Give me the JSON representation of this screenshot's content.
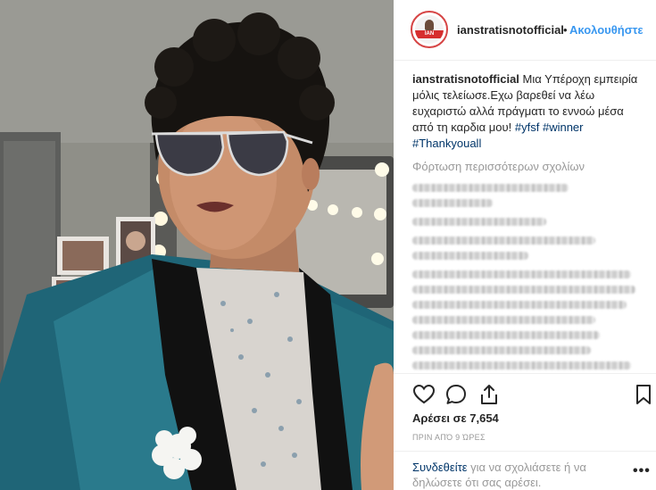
{
  "post": {
    "photo_name": "post-photo"
  },
  "header": {
    "username": "ianstratisnotofficial",
    "separator": "•",
    "follow_label": "Ακολουθήστε",
    "avatar_logo_text": "IAN"
  },
  "caption": {
    "username": "ianstratisnotofficial",
    "text": " Μια Υπέροχη εμπειρία μόλις τελείωσε.Εχω βαρεθεί να λέω ευχαριστώ αλλά πράγματι το εννοώ μέσα από τη καρδια μου! ",
    "hashtags": [
      "#yfsf",
      "#winner",
      "#Thankyouall"
    ]
  },
  "comments": {
    "load_more_label": "Φόρτωση περισσότερων σχολίων"
  },
  "actions": {
    "like_icon": "heart-icon",
    "comment_icon": "comment-icon",
    "share_icon": "share-icon",
    "save_icon": "bookmark-icon",
    "likes_text": "Αρέσει σε 7,654",
    "time_text": "ΠΡΙΝ ΑΠΌ 9 ΏΡΕΣ"
  },
  "footer": {
    "login_link": "Συνδεθείτε",
    "login_rest": " για να σχολιάσετε ή να δηλώσετε ότι σας αρέσει.",
    "more_label": "•••"
  },
  "colors": {
    "link_blue": "#3897f0",
    "hashtag_blue": "#003569",
    "muted_gray": "#999999",
    "avatar_ring": "#d64545"
  }
}
